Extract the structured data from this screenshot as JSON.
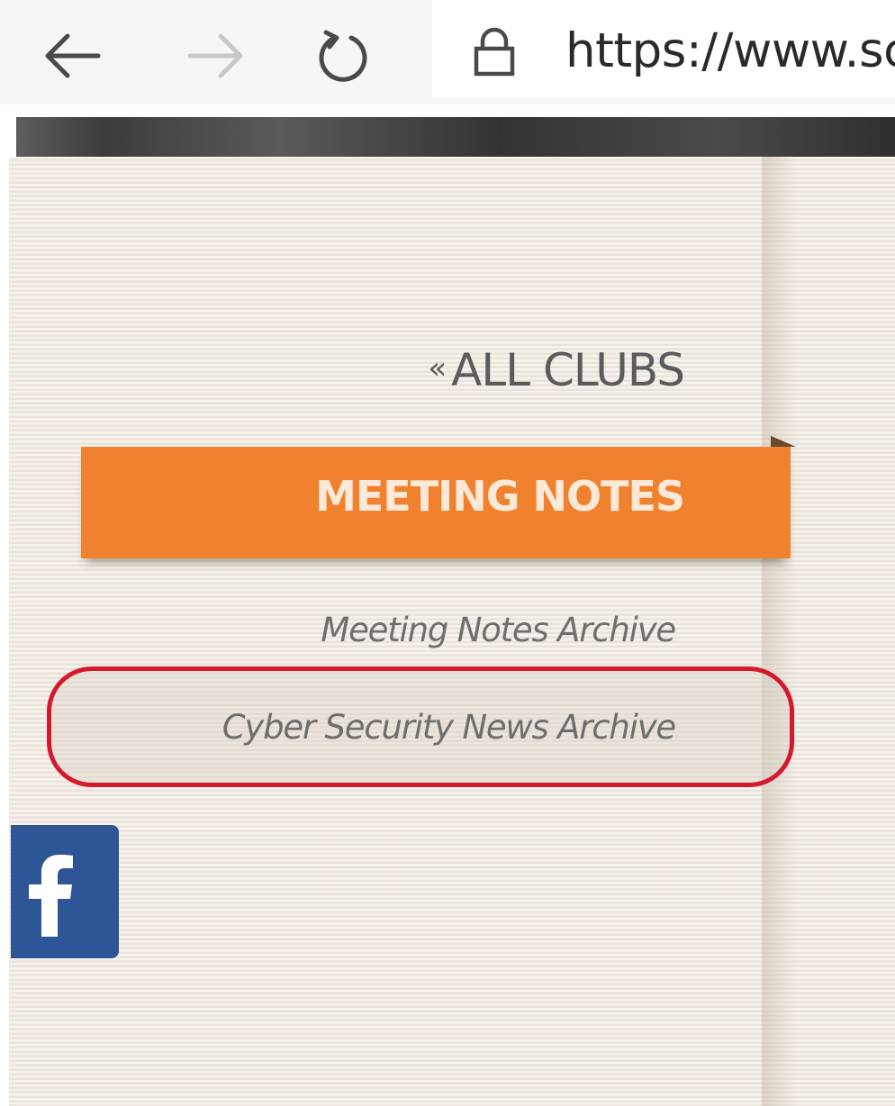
{
  "browser": {
    "url": "https://www.sc",
    "icons": {
      "back": "arrow-left-icon",
      "forward": "arrow-right-icon",
      "refresh": "refresh-icon",
      "security": "lock-icon"
    }
  },
  "sidebar": {
    "back_link": {
      "prefix": "«",
      "label": "ALL CLUBS"
    },
    "section_title": "MEETING NOTES",
    "links": [
      {
        "label": "Meeting Notes Archive"
      },
      {
        "label": "Cyber Security News Archive"
      }
    ]
  },
  "social": {
    "facebook": "facebook-icon"
  },
  "colors": {
    "accent": "#f0822f",
    "highlight": "#d4192c",
    "facebook": "#2e5596",
    "paper": "#f1ebe3"
  }
}
